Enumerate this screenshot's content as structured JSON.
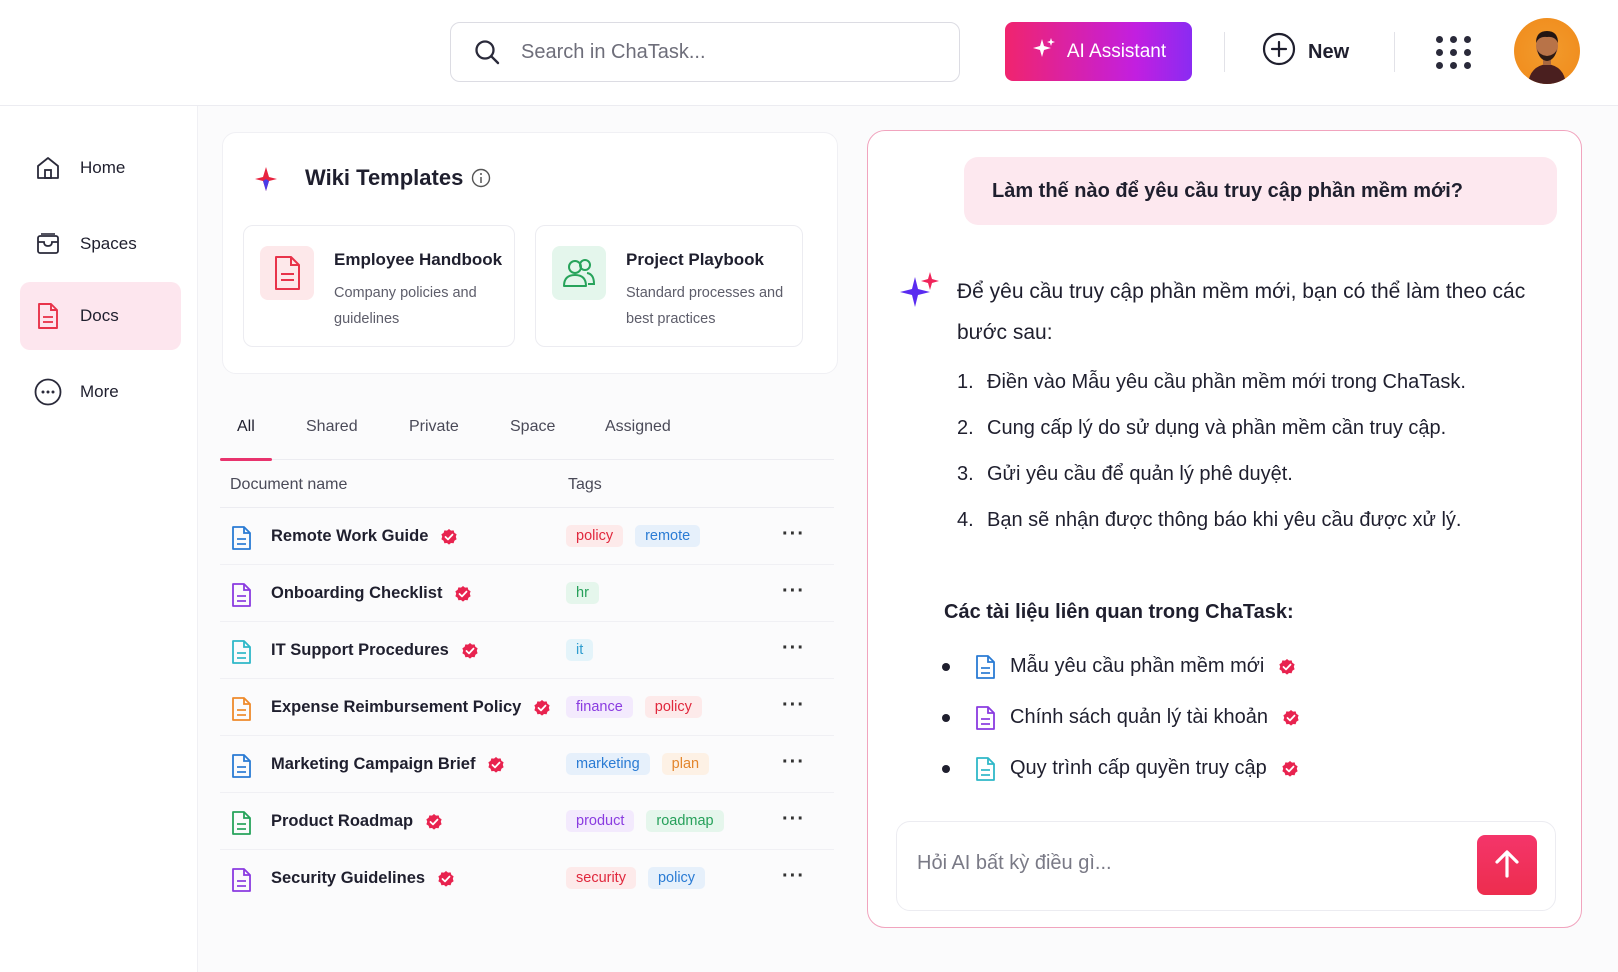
{
  "header": {
    "search_placeholder": "Search in ChaTask...",
    "ai_button_label": "AI Assistant",
    "new_button_label": "New",
    "search_icon": "search-icon",
    "apps_icon": "grid-icon",
    "avatar": "user-avatar"
  },
  "sidebar": {
    "items": [
      {
        "label": "Home",
        "icon": "home-icon"
      },
      {
        "label": "Spaces",
        "icon": "inbox-icon"
      },
      {
        "label": "Docs",
        "icon": "document-icon",
        "active": true
      },
      {
        "label": "More",
        "icon": "more-circle-icon"
      }
    ]
  },
  "templates": {
    "title": "Wiki Templates",
    "cards": [
      {
        "title": "Employee Handbook",
        "description": "Company policies and guidelines",
        "icon": "document-icon",
        "color": "#e8334a"
      },
      {
        "title": "Project Playbook",
        "description": "Standard processes and best practices",
        "icon": "users-icon",
        "color": "#27a35b"
      }
    ]
  },
  "tabs": [
    "All",
    "Shared",
    "Private",
    "Space",
    "Assigned"
  ],
  "table": {
    "headers": {
      "name": "Document name",
      "tags": "Tags"
    },
    "rows": [
      {
        "name": "Remote Work Guide",
        "icon_color": "#2a7bd4",
        "tags": [
          {
            "label": "policy",
            "cls": "t-policy"
          },
          {
            "label": "remote",
            "cls": "t-remote"
          }
        ]
      },
      {
        "name": "Onboarding Checklist",
        "icon_color": "#8a3be0",
        "tags": [
          {
            "label": "hr",
            "cls": "t-hr"
          }
        ]
      },
      {
        "name": "IT Support Procedures",
        "icon_color": "#2fb8c8",
        "tags": [
          {
            "label": "it",
            "cls": "t-it"
          }
        ]
      },
      {
        "name": "Expense Reimbursement Policy",
        "icon_color": "#ee8a2b",
        "tags": [
          {
            "label": "finance",
            "cls": "t-finance"
          },
          {
            "label": "policy",
            "cls": "t-policy"
          }
        ]
      },
      {
        "name": "Marketing Campaign Brief",
        "icon_color": "#2a7bd4",
        "tags": [
          {
            "label": "marketing",
            "cls": "t-marketing"
          },
          {
            "label": "plan",
            "cls": "t-plan"
          }
        ]
      },
      {
        "name": "Product Roadmap",
        "icon_color": "#27a35b",
        "tags": [
          {
            "label": "product",
            "cls": "t-product"
          },
          {
            "label": "roadmap",
            "cls": "t-roadmap"
          }
        ]
      },
      {
        "name": "Security Guidelines",
        "icon_color": "#8a3be0",
        "tags": [
          {
            "label": "security",
            "cls": "t-security"
          },
          {
            "label": "policy",
            "cls": "t-marketing"
          }
        ]
      }
    ],
    "more_label": "···"
  },
  "ai": {
    "user_question": "Làm thế nào để yêu cầu truy cập phần mềm mới?",
    "answer_intro": "Để yêu cầu truy cập phần mềm mới, bạn có thể làm theo các bước sau:",
    "steps": [
      "Điền vào Mẫu yêu cầu phần mềm mới trong ChaTask.",
      "Cung cấp lý do sử dụng và phần mềm cần truy cập.",
      "Gửi yêu cầu để quản lý phê duyệt.",
      "Bạn sẽ nhận được thông báo khi yêu cầu được xử lý."
    ],
    "related_title": "Các tài liệu liên quan trong ChaTask:",
    "related_docs": [
      {
        "label": "Mẫu yêu cầu phần mềm mới",
        "icon_color": "#2a7bd4"
      },
      {
        "label": "Chính sách quản lý tài khoản",
        "icon_color": "#8a3be0"
      },
      {
        "label": "Quy trình cấp quyền truy cập",
        "icon_color": "#2fb8c8"
      }
    ],
    "input_placeholder": "Hỏi AI bất kỳ điều gì...",
    "send_icon": "arrow-up-icon"
  },
  "colors": {
    "accent": "#e8336d",
    "verified_badge": "#e8234f"
  }
}
